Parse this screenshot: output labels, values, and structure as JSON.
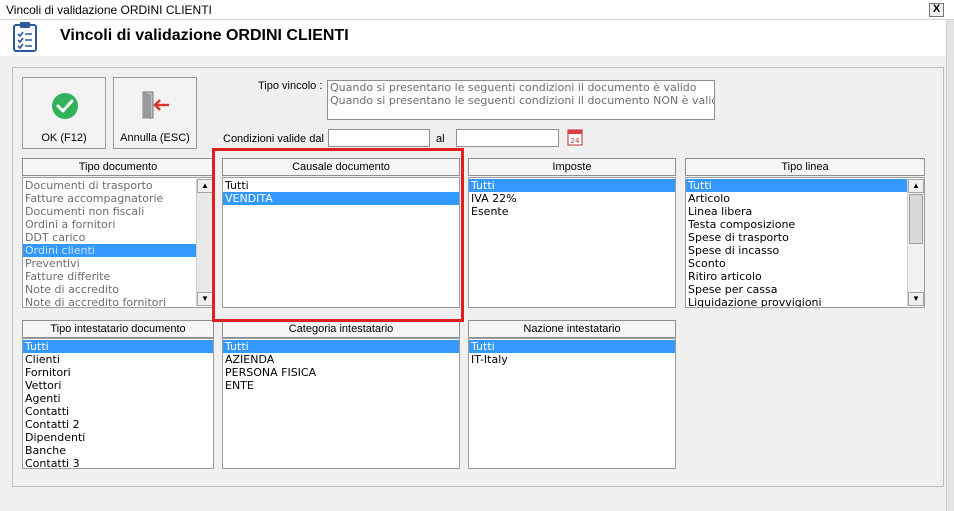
{
  "window": {
    "title": "Vincoli di validazione ORDINI CLIENTI",
    "close": "X"
  },
  "header": {
    "title": "Vincoli di validazione ORDINI CLIENTI",
    "icon": "clipboard-checklist-icon"
  },
  "toolbar": {
    "ok_label": "OK (F12)",
    "ok_icon": "check-circle-icon",
    "cancel_label": "Annulla (ESC)",
    "cancel_icon": "exit-door-icon"
  },
  "tipo_vincolo": {
    "label": "Tipo vincolo :",
    "options": [
      "Quando si presentano le seguenti condizioni il documento è valido",
      "Quando si presentano le seguenti condizioni il documento NON è valido"
    ],
    "selected_index": 0
  },
  "dates": {
    "label_from": "Condizioni valide dal",
    "label_to": "al",
    "from_value": "",
    "to_value": "",
    "calendar_icon": "calendar-icon",
    "calendar_text": "24"
  },
  "lists": {
    "tipo_documento": {
      "header": "Tipo documento",
      "items": [
        "Documenti di trasporto",
        "Fatture accompagnatorie",
        "Documenti non fiscali",
        "Ordini a fornitori",
        "DDT carico",
        "Ordini clienti",
        "Preventivi",
        "Fatture differite",
        "Note di accredito",
        "Note di accredito fornitori"
      ],
      "selected": 5
    },
    "causale_documento": {
      "header": "Causale documento",
      "items": [
        "Tutti",
        "VENDITA"
      ],
      "selected": 1
    },
    "imposte": {
      "header": "Imposte",
      "items": [
        "Tutti",
        "IVA 22%",
        "Esente"
      ],
      "selected": 0
    },
    "tipo_linea": {
      "header": "Tipo linea",
      "items": [
        "Tutti",
        "Articolo",
        "Linea libera",
        "Testa composizione",
        "Spese di trasporto",
        "Spese di incasso",
        "Sconto",
        "Ritiro articolo",
        "Spese per cassa",
        "Liquidazione provvigioni"
      ],
      "selected": 0
    },
    "tipo_intestatario": {
      "header": "Tipo intestatario documento",
      "items": [
        "Tutti",
        "Clienti",
        "Fornitori",
        "Vettori",
        "Agenti",
        "Contatti",
        "Contatti 2",
        "Dipendenti",
        "Banche",
        "Contatti 3"
      ],
      "selected": 0
    },
    "categoria_intestatario": {
      "header": "Categoria intestatario",
      "items": [
        "Tutti",
        "AZIENDA",
        "PERSONA FISICA",
        "ENTE"
      ],
      "selected": 0
    },
    "nazione_intestatario": {
      "header": "Nazione intestatario",
      "items": [
        "Tutti",
        "IT-Italy"
      ],
      "selected": 0
    }
  },
  "colors": {
    "selection": "#3399ff",
    "highlight": "#e02020",
    "ok_green": "#2fb35a",
    "exit_red": "#d9342b"
  }
}
